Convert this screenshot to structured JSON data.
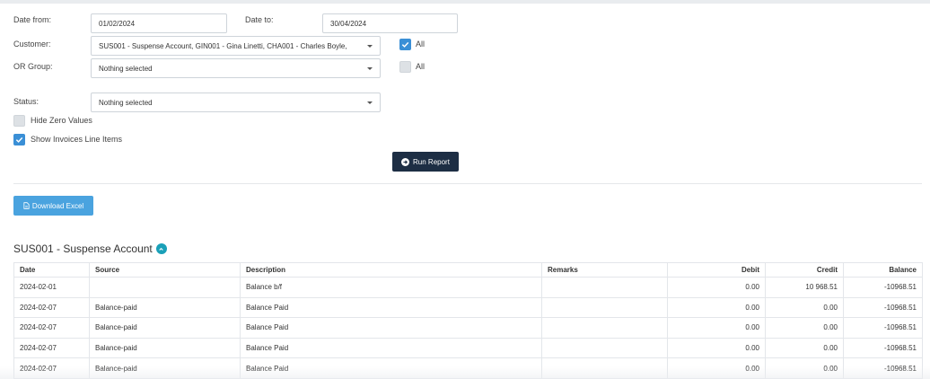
{
  "filters": {
    "date_from_label": "Date from:",
    "date_from_value": "01/02/2024",
    "date_to_label": "Date to:",
    "date_to_value": "30/04/2024",
    "customer_label": "Customer:",
    "customer_value": "SUS001 - Suspense Account, GIN001 - Gina Linetti, CHA001 - Charles Boyle,",
    "customer_all_label": "All",
    "or_group_label": "OR Group:",
    "or_group_value": "Nothing selected",
    "or_group_all_label": "All",
    "status_label": "Status:",
    "status_value": "Nothing selected",
    "hide_zero_label": "Hide Zero Values",
    "show_invoice_lines_label": "Show Invoices Line Items"
  },
  "actions": {
    "run_report_label": "Run Report",
    "download_excel_label": "Download Excel"
  },
  "section": {
    "title": "SUS001 - Suspense Account"
  },
  "table": {
    "headers": [
      "Date",
      "Source",
      "Description",
      "Remarks",
      "Debit",
      "Credit",
      "Balance"
    ],
    "rows": [
      [
        "2024-02-01",
        "",
        "Balance b/f",
        "",
        "0.00",
        "10 968.51",
        "-10968.51"
      ],
      [
        "2024-02-07",
        "Balance-paid",
        "Balance Paid",
        "",
        "0.00",
        "0.00",
        "-10968.51"
      ],
      [
        "2024-02-07",
        "Balance-paid",
        "Balance Paid",
        "",
        "0.00",
        "0.00",
        "-10968.51"
      ],
      [
        "2024-02-07",
        "Balance-paid",
        "Balance Paid",
        "",
        "0.00",
        "0.00",
        "-10968.51"
      ],
      [
        "2024-02-07",
        "Balance-paid",
        "Balance Paid",
        "",
        "0.00",
        "0.00",
        "-10968.51"
      ]
    ]
  },
  "colors": {
    "checkbox_checked": "#3a8fd6",
    "run_report_bg": "#1d2e44",
    "download_bg": "#4aa3df",
    "section_toggle": "#1aa0b8"
  },
  "icons": {
    "run_report": "circle-arrow-right-icon",
    "download": "file-icon",
    "section_toggle": "chevron-up-circle-icon",
    "dropdown": "caret-down-icon",
    "check": "check-icon"
  }
}
